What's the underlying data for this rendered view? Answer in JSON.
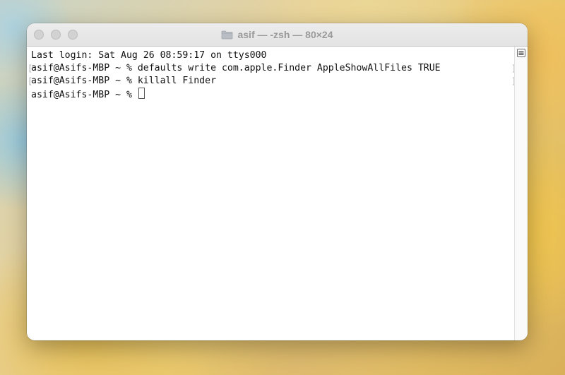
{
  "window": {
    "title": "asif — -zsh — 80×24"
  },
  "terminal": {
    "lines": [
      {
        "text": "Last login: Sat Aug 26 08:59:17 on ttys000",
        "marked": false
      },
      {
        "text": "asif@Asifs-MBP ~ % defaults write com.apple.Finder AppleShowAllFiles TRUE",
        "marked": true
      },
      {
        "text": "asif@Asifs-MBP ~ % killall Finder",
        "marked": true
      },
      {
        "text": "asif@Asifs-MBP ~ % ",
        "marked": false
      }
    ],
    "mark_left": "[",
    "mark_right": "]"
  },
  "icons": {
    "folder": "folder-icon",
    "marks": "marks-icon"
  },
  "colors": {
    "text": "#111111",
    "title": "#9a9a9a",
    "background": "#ffffff"
  }
}
